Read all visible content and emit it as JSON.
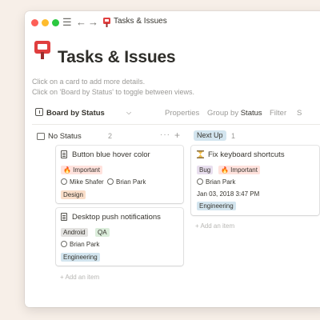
{
  "titlebar": {
    "title": "Tasks & Issues"
  },
  "page": {
    "title": "Tasks & Issues",
    "description_line1": "Click on a card to add more details.",
    "description_line2": "Click on 'Board by Status' to toggle between views."
  },
  "viewbar": {
    "view_name": "Board by Status",
    "caret": "⌵",
    "properties_label": "Properties",
    "group_by_prefix": "Group by ",
    "group_by_value": "Status",
    "filter_label": "Filter",
    "truncated_label": "S"
  },
  "columns": [
    {
      "label": "No Status",
      "count": "2",
      "more": "···",
      "plus": "+",
      "add_item_label": "+ Add an item",
      "cards": [
        {
          "title": "Button blue hover color",
          "tags": [
            {
              "label": "🔥 Important"
            }
          ],
          "people": [
            "Mike Shafer",
            "Brian Park"
          ],
          "category": "Design"
        },
        {
          "title": "Desktop push notifications",
          "tags": [
            {
              "label": "Android"
            },
            {
              "label": "QA"
            }
          ],
          "people": [
            "Brian Park"
          ],
          "category": "Engineering"
        }
      ]
    },
    {
      "label": "Next Up",
      "count": "1",
      "add_item_label": "+ Add an item",
      "cards": [
        {
          "title": "Fix keyboard shortcuts",
          "tags": [
            {
              "label": "Bug"
            },
            {
              "label": "🔥 Important"
            }
          ],
          "people": [
            "Brian Park"
          ],
          "date": "Jan 03, 2018 3:47 PM",
          "category": "Engineering"
        }
      ]
    }
  ],
  "colors": {
    "background": "#f7efe8",
    "page_icon_red": "#e03e3e",
    "next_up_pill": "#d3e5ef"
  },
  "icons": {
    "page_icon": "red-pushpin-flag-icon",
    "menu": "hamburger-icon",
    "back": "arrow-left-icon",
    "forward": "arrow-right-icon",
    "view": "board-icon",
    "card": "document-icon",
    "card_emoji": "hourglass-icon"
  }
}
